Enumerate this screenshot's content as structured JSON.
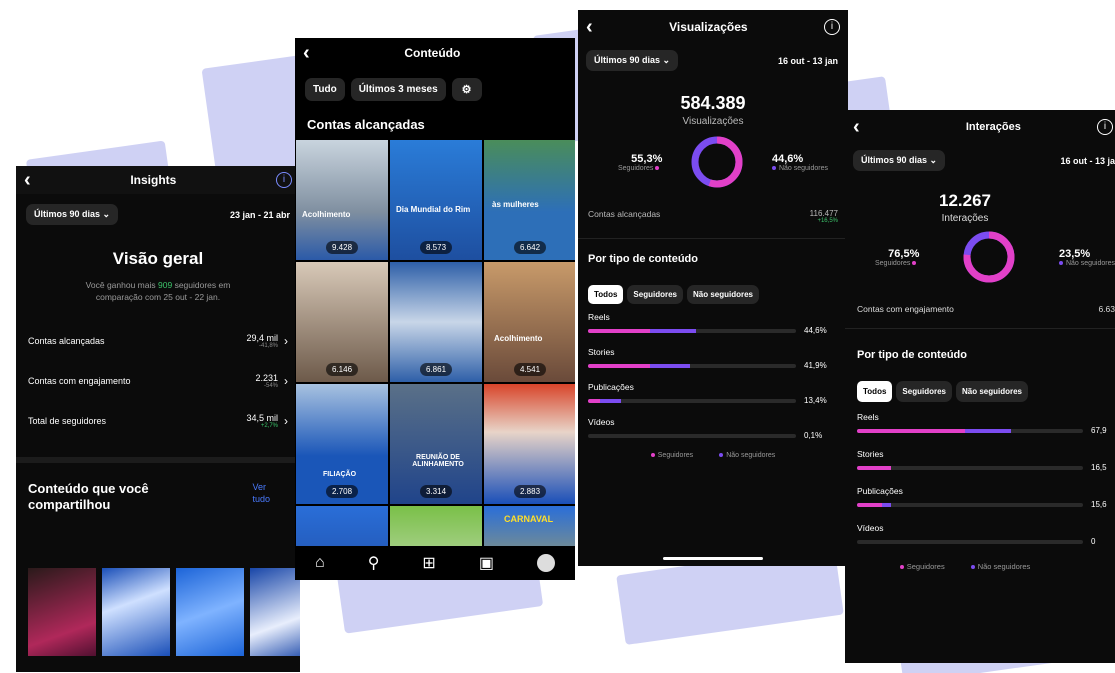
{
  "colors": {
    "followers": "#e240c8",
    "non_followers": "#7b4cf0",
    "positive": "#3cc36a",
    "deco": "#c7c9f2"
  },
  "insights": {
    "title": "Insights",
    "range": "Últimos 90 dias",
    "dates": "23 jan - 21 abr",
    "overview_title": "Visão geral",
    "gain_prefix": "Você ganhou mais",
    "gain_value": "909",
    "gain_suffix": "seguidores em",
    "gain_line2": "comparação com 25 out - 22 jan.",
    "metrics": [
      {
        "label": "Contas alcançadas",
        "value": "29,4 mil",
        "delta": "-41,8%"
      },
      {
        "label": "Contas com engajamento",
        "value": "2.231",
        "delta": "-54%"
      },
      {
        "label": "Total de seguidores",
        "value": "34,5 mil",
        "delta": "+2,7%"
      }
    ],
    "shared_title_1": "Conteúdo que você",
    "shared_title_2": "compartilhou",
    "see_all_1": "Ver",
    "see_all_2": "tudo"
  },
  "content": {
    "title": "Conteúdo",
    "filters": [
      "Tudo",
      "Últimos 3 meses"
    ],
    "section": "Contas alcançadas",
    "tiles": [
      {
        "count": "9.428",
        "caption": "Acolhimento"
      },
      {
        "count": "8.573",
        "caption": "Dia Mundial do Rim"
      },
      {
        "count": "6.642",
        "caption": "às mulheres"
      },
      {
        "count": "6.146",
        "caption": ""
      },
      {
        "count": "6.861",
        "caption": ""
      },
      {
        "count": "4.541",
        "caption": "Acolhimento"
      },
      {
        "count": "2.708",
        "caption": "FILIAÇÃO"
      },
      {
        "count": "3.314",
        "caption": "REUNIÃO DE ALINHAMENTO"
      },
      {
        "count": "2.883",
        "caption": ""
      },
      {
        "count": "",
        "caption": ""
      },
      {
        "count": "",
        "caption": ""
      },
      {
        "count": "",
        "caption": "CARNAVAL"
      }
    ]
  },
  "views": {
    "title": "Visualizações",
    "range": "Últimos 90 dias",
    "dates": "16 out - 13 jan",
    "total": "584.389",
    "total_label": "Visualizações",
    "followers_pct": "55,3%",
    "followers_label": "Seguidores",
    "followers_fraction": 0.553,
    "non_followers_pct": "44,6%",
    "non_followers_label": "Não seguidores",
    "reach_label": "Contas alcançadas",
    "reach_value": "116.477",
    "reach_delta": "+16,5%",
    "by_type": "Por tipo de conteúdo",
    "tabs": [
      "Todos",
      "Seguidores",
      "Não seguidores"
    ],
    "types": [
      {
        "label": "Reels",
        "pct": "44,6%",
        "followers": 0.3,
        "non_followers": 0.52
      },
      {
        "label": "Stories",
        "pct": "41,9%",
        "followers": 0.3,
        "non_followers": 0.49
      },
      {
        "label": "Publicações",
        "pct": "13,4%",
        "followers": 0.06,
        "non_followers": 0.16
      },
      {
        "label": "Vídeos",
        "pct": "0,1%",
        "followers": 0,
        "non_followers": 0
      }
    ],
    "legend": [
      "Seguidores",
      "Não seguidores"
    ]
  },
  "interactions": {
    "title": "Interações",
    "range": "Últimos 90 dias",
    "dates": "16 out - 13 ja",
    "total": "12.267",
    "total_label": "Interações",
    "followers_pct": "76,5%",
    "followers_label": "Seguidores",
    "followers_fraction": 0.765,
    "non_followers_pct": "23,5%",
    "non_followers_label": "Não seguidores",
    "engaged_label": "Contas com engajamento",
    "engaged_value": "6.63",
    "by_type": "Por tipo de conteúdo",
    "tabs": [
      "Todos",
      "Seguidores",
      "Não seguidores"
    ],
    "types": [
      {
        "label": "Reels",
        "pct": "67,9",
        "followers": 0.48,
        "non_followers": 0.68
      },
      {
        "label": "Stories",
        "pct": "16,5",
        "followers": 0.15,
        "non_followers": 0.15
      },
      {
        "label": "Publicações",
        "pct": "15,6",
        "followers": 0.11,
        "non_followers": 0.15
      },
      {
        "label": "Vídeos",
        "pct": "0",
        "followers": 0,
        "non_followers": 0
      }
    ],
    "legend": [
      "Seguidores",
      "Não seguidores"
    ]
  }
}
